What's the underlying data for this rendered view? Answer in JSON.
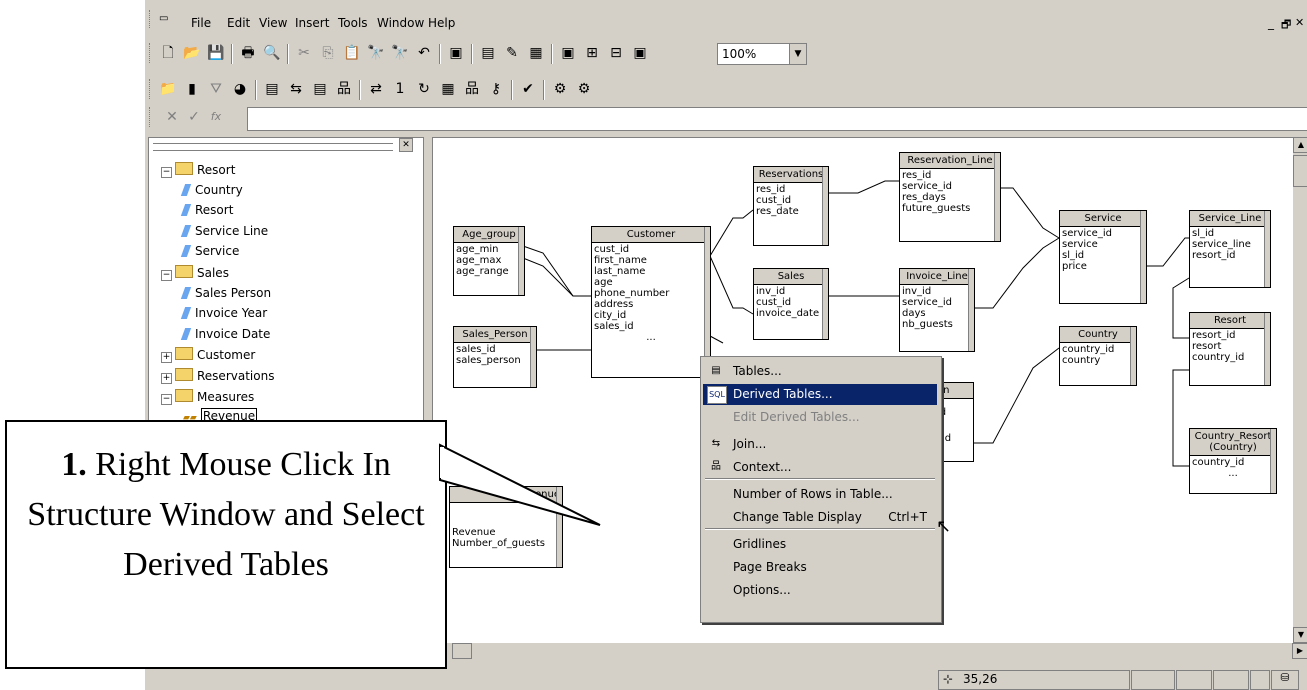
{
  "menu": [
    "File",
    "Edit",
    "View",
    "Insert",
    "Tools",
    "Window",
    "Help"
  ],
  "window_controls": [
    "_",
    "🗗",
    "✕"
  ],
  "zoom": {
    "value": "100%"
  },
  "tree": {
    "items": [
      {
        "label": "Resort",
        "type": "folder",
        "level": 0,
        "expander": "−"
      },
      {
        "label": "Country",
        "type": "object",
        "level": 1
      },
      {
        "label": "Resort",
        "type": "object",
        "level": 1
      },
      {
        "label": "Service Line",
        "type": "object",
        "level": 1
      },
      {
        "label": "Service",
        "type": "object",
        "level": 1
      },
      {
        "label": "Sales",
        "type": "folder",
        "level": 0,
        "expander": "−"
      },
      {
        "label": "Sales Person",
        "type": "object",
        "level": 1
      },
      {
        "label": "Invoice Year",
        "type": "object",
        "level": 1
      },
      {
        "label": "Invoice Date",
        "type": "object",
        "level": 1
      },
      {
        "label": "Customer",
        "type": "folder",
        "level": 0,
        "expander": "+"
      },
      {
        "label": "Reservations",
        "type": "folder",
        "level": 0,
        "expander": "+"
      },
      {
        "label": "Measures",
        "type": "folder",
        "level": 0,
        "expander": "−"
      },
      {
        "label": "Revenue",
        "type": "measure",
        "level": 1
      }
    ]
  },
  "tables": [
    {
      "name": "Reservations",
      "cols": [
        "res_id",
        "cust_id",
        "res_date"
      ]
    },
    {
      "name": "Reservation_Line",
      "cols": [
        "res_id",
        "service_id",
        "res_days",
        "future_guests"
      ]
    },
    {
      "name": "Age_group",
      "cols": [
        "age_min",
        "age_max",
        "age_range"
      ]
    },
    {
      "name": "Customer",
      "cols": [
        "cust_id",
        "first_name",
        "last_name",
        "age",
        "phone_number",
        "address",
        "city_id",
        "sales_id",
        "..."
      ]
    },
    {
      "name": "Sales",
      "cols": [
        "inv_id",
        "cust_id",
        "invoice_date"
      ]
    },
    {
      "name": "Invoice_Line",
      "cols": [
        "inv_id",
        "service_id",
        "days",
        "nb_guests"
      ]
    },
    {
      "name": "Service",
      "cols": [
        "service_id",
        "service",
        "sl_id",
        "price"
      ]
    },
    {
      "name": "Service_Line",
      "cols": [
        "sl_id",
        "service_line",
        "resort_id"
      ]
    },
    {
      "name": "Sales_Person",
      "cols": [
        "sales_id",
        "sales_person"
      ]
    },
    {
      "name": "Country",
      "cols": [
        "country_id",
        "country"
      ]
    },
    {
      "name": "Resort",
      "cols": [
        "resort_id",
        "resort",
        "country_id"
      ]
    },
    {
      "name": "Country_Resort\n(Country)",
      "cols": [
        "country_id",
        "..."
      ]
    },
    {
      "name": "venue",
      "cols": [
        "Revenue",
        "Number_of_guests"
      ]
    }
  ],
  "partial_table_fragments": [
    "on",
    "id",
    "_id"
  ],
  "context_menu": [
    {
      "label": "Tables...",
      "icon": "tables-icon",
      "state": "normal"
    },
    {
      "label": "Derived Tables...",
      "icon": "sql-icon",
      "state": "selected"
    },
    {
      "label": "Edit Derived Tables...",
      "icon": "",
      "state": "disabled"
    },
    {
      "label": "Join...",
      "icon": "join-icon",
      "state": "normal"
    },
    {
      "label": "Context...",
      "icon": "context-icon",
      "state": "normal"
    },
    {
      "label": "Number of Rows in Table...",
      "icon": "",
      "state": "normal"
    },
    {
      "label": "Change Table Display",
      "icon": "",
      "state": "normal",
      "shortcut": "Ctrl+T"
    },
    {
      "label": "Gridlines",
      "icon": "",
      "state": "normal"
    },
    {
      "label": "Page Breaks",
      "icon": "",
      "state": "normal"
    },
    {
      "label": "Options...",
      "icon": "",
      "state": "normal"
    }
  ],
  "status": {
    "coords": "35,26"
  },
  "callout": {
    "bold": "1.",
    "text": " Right Mouse Click In Structure Window and Select Derived Tables"
  }
}
